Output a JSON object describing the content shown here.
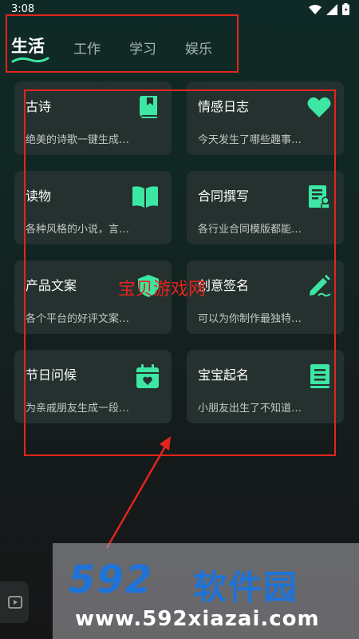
{
  "status": {
    "time": "3:08"
  },
  "tabs": [
    {
      "label": "生活",
      "active": true
    },
    {
      "label": "工作",
      "active": false
    },
    {
      "label": "学习",
      "active": false
    },
    {
      "label": "娱乐",
      "active": false
    }
  ],
  "cards": [
    {
      "title": "古诗",
      "desc": "绝美的诗歌一键生成…",
      "icon": "book-bookmark-icon"
    },
    {
      "title": "情感日志",
      "desc": "今天发生了哪些趣事…",
      "icon": "heart-icon"
    },
    {
      "title": "读物",
      "desc": "各种风格的小说，言…",
      "icon": "open-book-icon"
    },
    {
      "title": "合同撰写",
      "desc": "各行业合同模版都能…",
      "icon": "contract-icon"
    },
    {
      "title": "产品文案",
      "desc": "各个平台的好评文案…",
      "icon": "shield-icon"
    },
    {
      "title": "创意签名",
      "desc": "可以为你制作最独特…",
      "icon": "pen-signature-icon"
    },
    {
      "title": "节日问候",
      "desc": "为亲戚朋友生成一段…",
      "icon": "calendar-heart-icon"
    },
    {
      "title": "宝宝起名",
      "desc": "小朋友出生了不知道…",
      "icon": "notebook-icon"
    }
  ],
  "overlay": {
    "watermark": "宝贝游戏网",
    "logo_number": "592",
    "logo_text": "软件园",
    "logo_url": "www.592xiazai.com"
  },
  "colors": {
    "accent": "#3de6a3",
    "card_bg": "#24312f",
    "annotation_red": "#e2241d",
    "logo_blue": "#1e73d8"
  }
}
